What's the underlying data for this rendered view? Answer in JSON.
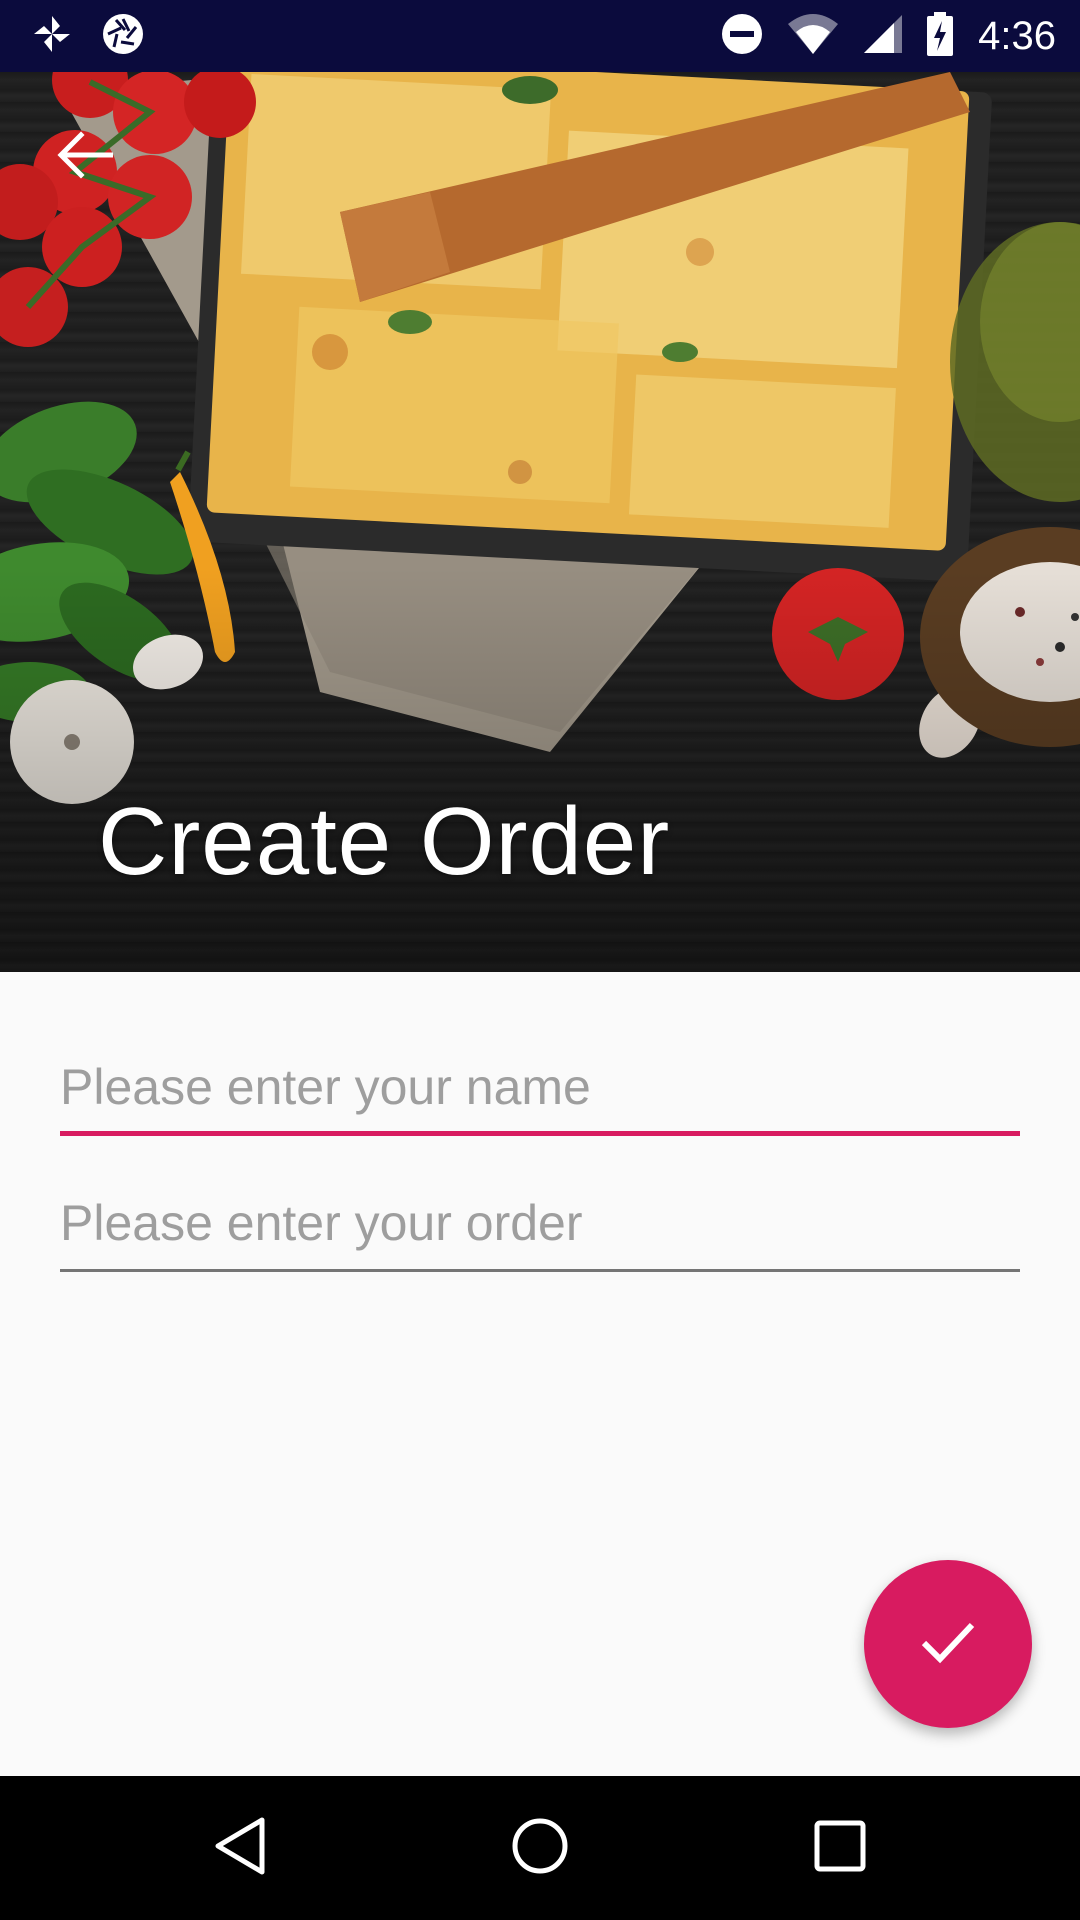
{
  "status_bar": {
    "time": "4:36",
    "icons": [
      "pinwheel-icon",
      "aperture-icon",
      "do-not-disturb-icon",
      "wifi-icon",
      "cellular-signal-icon",
      "battery-charging-icon"
    ]
  },
  "header": {
    "title": "Create Order",
    "back_icon": "arrow-back-icon"
  },
  "form": {
    "name_field": {
      "placeholder": "Please enter your name",
      "value": "",
      "focused": true
    },
    "order_field": {
      "placeholder": "Please enter your order",
      "value": "",
      "focused": false
    }
  },
  "fab": {
    "icon": "check-icon"
  },
  "nav_bar": {
    "icons": [
      "nav-back-icon",
      "nav-home-icon",
      "nav-recents-icon"
    ]
  },
  "colors": {
    "accent": "#d81b60",
    "status_bar": "#0b0b3d",
    "background": "#fafafa",
    "nav_bar": "#000000"
  }
}
